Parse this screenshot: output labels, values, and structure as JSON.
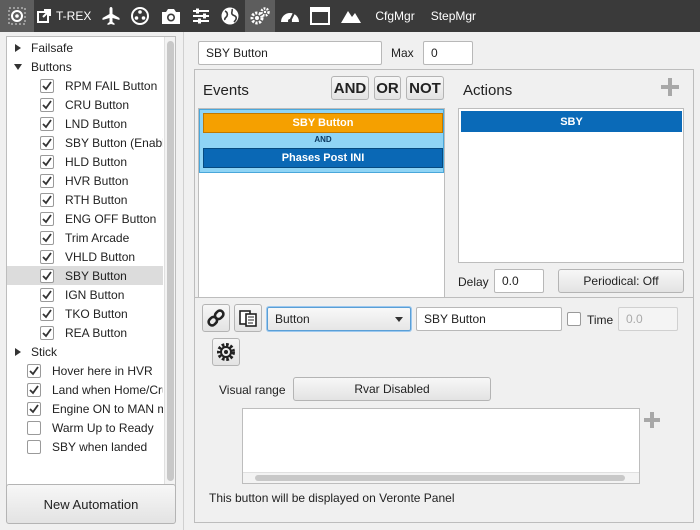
{
  "toolbar": {
    "app_name": "T-REX",
    "cfgmgr_label": "CfgMgr",
    "stepmgr_label": "StepMgr"
  },
  "tree": {
    "failsafe_label": "Failsafe",
    "buttons_label": "Buttons",
    "button_items": [
      {
        "label": "RPM FAIL Button",
        "checked": true
      },
      {
        "label": "CRU Button",
        "checked": true
      },
      {
        "label": "LND Button",
        "checked": true
      },
      {
        "label": "SBY Button (Enabled)",
        "checked": true
      },
      {
        "label": "HLD Button",
        "checked": true
      },
      {
        "label": "HVR Button",
        "checked": true
      },
      {
        "label": "RTH Button",
        "checked": true
      },
      {
        "label": "ENG OFF Button",
        "checked": true
      },
      {
        "label": "Trim Arcade",
        "checked": true
      },
      {
        "label": "VHLD Button",
        "checked": true
      },
      {
        "label": "SBY Button",
        "checked": true,
        "selected": true
      },
      {
        "label": "IGN Button",
        "checked": true
      },
      {
        "label": "TKO Button",
        "checked": true
      },
      {
        "label": "REA Button",
        "checked": true
      }
    ],
    "stick_label": "Stick",
    "other_items": [
      {
        "label": "Hover here in HVR",
        "checked": true
      },
      {
        "label": "Land when Home/Cruise",
        "checked": true
      },
      {
        "label": "Engine ON to MAN mode",
        "checked": true
      },
      {
        "label": "Warm Up to Ready",
        "checked": false
      },
      {
        "label": "SBY when landed",
        "checked": false
      }
    ]
  },
  "new_automation_label": "New Automation",
  "automation": {
    "name": "SBY Button",
    "max_label": "Max",
    "max_value": "0"
  },
  "events": {
    "title": "Events",
    "and_label": "AND",
    "or_label": "OR",
    "not_label": "NOT",
    "event1": "SBY Button",
    "connector": "AND",
    "event2": "Phases Post INI",
    "event1_color": "#f5a000",
    "event2_color": "#0a68b5"
  },
  "actions": {
    "title": "Actions",
    "item": "SBY",
    "item_color": "#0a6ab8",
    "delay_label": "Delay",
    "delay_value": "0.0",
    "periodical_label": "Periodical: Off"
  },
  "editor": {
    "type_value": "Button",
    "name_value": "SBY Button",
    "time_label": "Time",
    "time_value": "0.0",
    "visual_range_label": "Visual range",
    "rvar_label": "Rvar Disabled",
    "footer": "This button will be displayed on Veronte Panel"
  }
}
